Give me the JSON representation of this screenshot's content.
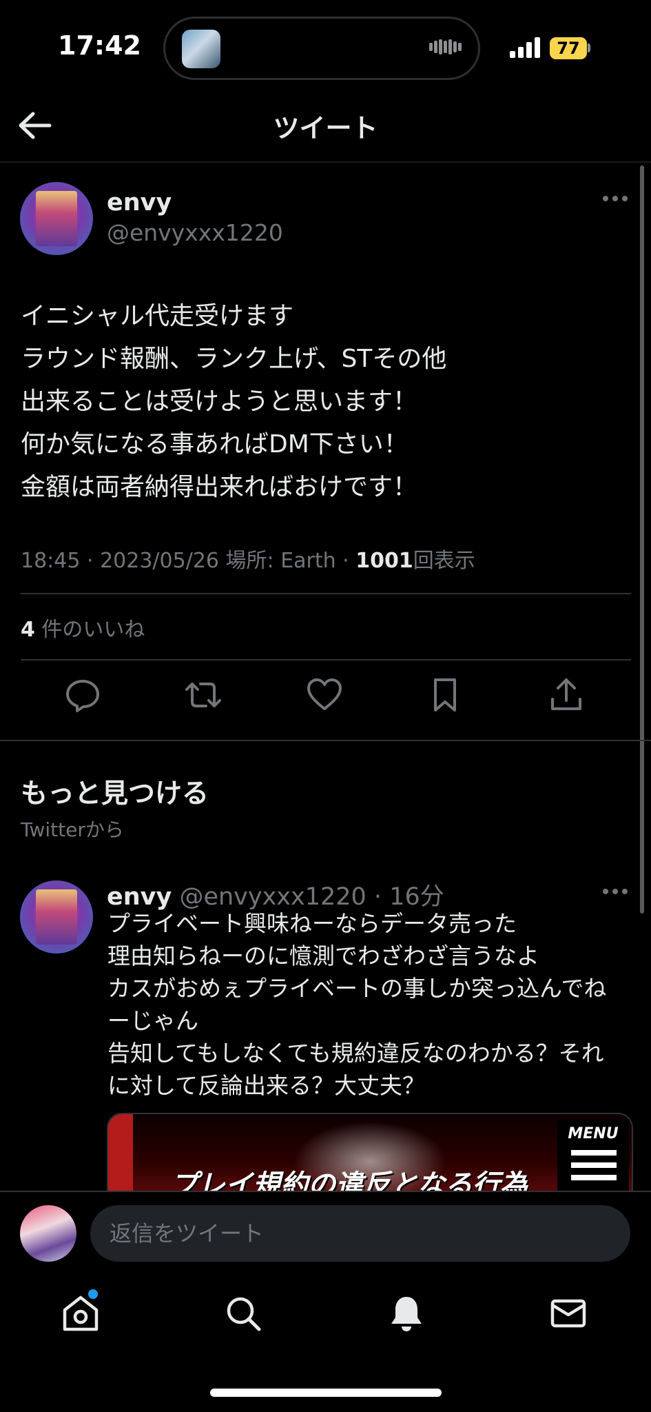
{
  "status_bar": {
    "time": "17:42",
    "battery": "77"
  },
  "header": {
    "title": "ツイート"
  },
  "main_tweet": {
    "name": "envy",
    "handle": "@envyxxx1220",
    "text_lines": [
      "イニシャル代走受けます",
      "ラウンド報酬、ランク上げ、STその他",
      "出来ることは受けようと思います！",
      "何か気になる事あればDM下さい！",
      "金額は両者納得出来ればおけです！"
    ],
    "meta": {
      "time": "18:45",
      "date": "2023/05/26",
      "location": "場所: Earth",
      "views_count": "1001",
      "views_label": "回表示"
    },
    "likes": {
      "count": "4",
      "label": "件のいいね"
    }
  },
  "discover": {
    "title": "もっと見つける",
    "subtitle": "Twitterから"
  },
  "second_tweet": {
    "name": "envy",
    "handle": "@envyxxx1220",
    "time": "16分",
    "text_lines": [
      "プライベート興味ねーならデータ売った",
      "理由知らねーのに憶測でわざわざ言うなよ",
      "カスがおめぇプライベートの事しか突っ込んでね",
      "ーじゃん",
      "告知してもしなくても規約違反なのわかる？それ",
      "に対して反論出来る？大丈夫？"
    ],
    "card": {
      "headline": "プレイ規約の違反となる行為",
      "menu_label": "MENU"
    }
  },
  "reply": {
    "placeholder": "返信をツイート"
  },
  "icons": {
    "back": "arrow-left-icon",
    "more": "more-horizontal-icon",
    "reply": "comment-icon",
    "retweet": "retweet-icon",
    "like": "heart-icon",
    "bookmark": "bookmark-icon",
    "share": "share-icon",
    "home": "home-icon",
    "search": "search-icon",
    "notifications": "bell-icon",
    "messages": "mail-icon"
  },
  "colors": {
    "background": "#000000",
    "text": "#e7e9ea",
    "secondary": "#71767b",
    "accent": "#1d9bf0",
    "battery": "#f8d54c"
  }
}
